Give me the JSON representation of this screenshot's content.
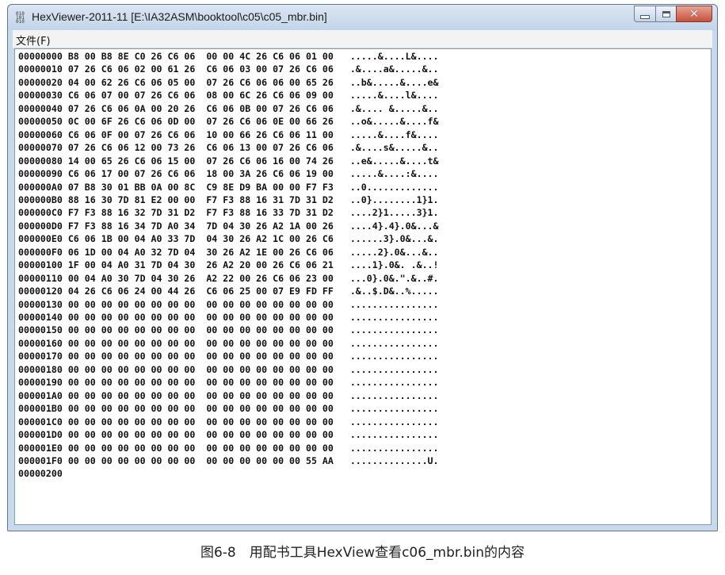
{
  "window": {
    "title": "HexViewer-2011-11 [E:\\IA32ASM\\booktool\\c05\\c05_mbr.bin]",
    "icon": "hex-app-icon"
  },
  "menu": {
    "file_label": "文件(F)"
  },
  "hexdump": {
    "rows": [
      {
        "offset": "00000000",
        "bytes": "B8 00 B8 8E C0 26 C6 06  00 00 4C 26 C6 06 01 00",
        "ascii": ".....&....L&...."
      },
      {
        "offset": "00000010",
        "bytes": "07 26 C6 06 02 00 61 26  C6 06 03 00 07 26 C6 06",
        "ascii": ".&....a&.....&.."
      },
      {
        "offset": "00000020",
        "bytes": "04 00 62 26 C6 06 05 00  07 26 C6 06 06 00 65 26",
        "ascii": "..b&.....&....e&"
      },
      {
        "offset": "00000030",
        "bytes": "C6 06 07 00 07 26 C6 06  08 00 6C 26 C6 06 09 00",
        "ascii": ".....&....l&...."
      },
      {
        "offset": "00000040",
        "bytes": "07 26 C6 06 0A 00 20 26  C6 06 0B 00 07 26 C6 06",
        "ascii": ".&.... &.....&.."
      },
      {
        "offset": "00000050",
        "bytes": "0C 00 6F 26 C6 06 0D 00  07 26 C6 06 0E 00 66 26",
        "ascii": "..o&.....&....f&"
      },
      {
        "offset": "00000060",
        "bytes": "C6 06 0F 00 07 26 C6 06  10 00 66 26 C6 06 11 00",
        "ascii": ".....&....f&...."
      },
      {
        "offset": "00000070",
        "bytes": "07 26 C6 06 12 00 73 26  C6 06 13 00 07 26 C6 06",
        "ascii": ".&....s&.....&.."
      },
      {
        "offset": "00000080",
        "bytes": "14 00 65 26 C6 06 15 00  07 26 C6 06 16 00 74 26",
        "ascii": "..e&.....&....t&"
      },
      {
        "offset": "00000090",
        "bytes": "C6 06 17 00 07 26 C6 06  18 00 3A 26 C6 06 19 00",
        "ascii": ".....&....:&...."
      },
      {
        "offset": "000000A0",
        "bytes": "07 B8 30 01 BB 0A 00 8C  C9 8E D9 BA 00 00 F7 F3",
        "ascii": "..0............."
      },
      {
        "offset": "000000B0",
        "bytes": "88 16 30 7D 81 E2 00 00  F7 F3 88 16 31 7D 31 D2",
        "ascii": "..0}........1}1."
      },
      {
        "offset": "000000C0",
        "bytes": "F7 F3 88 16 32 7D 31 D2  F7 F3 88 16 33 7D 31 D2",
        "ascii": "....2}1.....3}1."
      },
      {
        "offset": "000000D0",
        "bytes": "F7 F3 88 16 34 7D A0 34  7D 04 30 26 A2 1A 00 26",
        "ascii": "....4}.4}.0&...&"
      },
      {
        "offset": "000000E0",
        "bytes": "C6 06 1B 00 04 A0 33 7D  04 30 26 A2 1C 00 26 C6",
        "ascii": "......3}.0&...&."
      },
      {
        "offset": "000000F0",
        "bytes": "06 1D 00 04 A0 32 7D 04  30 26 A2 1E 00 26 C6 06",
        "ascii": ".....2}.0&...&.."
      },
      {
        "offset": "00000100",
        "bytes": "1F 00 04 A0 31 7D 04 30  26 A2 20 00 26 C6 06 21",
        "ascii": "....1}.0&. .&..!"
      },
      {
        "offset": "00000110",
        "bytes": "00 04 A0 30 7D 04 30 26  A2 22 00 26 C6 06 23 00",
        "ascii": "...0}.0&.\".&..#."
      },
      {
        "offset": "00000120",
        "bytes": "04 26 C6 06 24 00 44 26  C6 06 25 00 07 E9 FD FF",
        "ascii": ".&..$.D&..%....."
      },
      {
        "offset": "00000130",
        "bytes": "00 00 00 00 00 00 00 00  00 00 00 00 00 00 00 00",
        "ascii": "................"
      },
      {
        "offset": "00000140",
        "bytes": "00 00 00 00 00 00 00 00  00 00 00 00 00 00 00 00",
        "ascii": "................"
      },
      {
        "offset": "00000150",
        "bytes": "00 00 00 00 00 00 00 00  00 00 00 00 00 00 00 00",
        "ascii": "................"
      },
      {
        "offset": "00000160",
        "bytes": "00 00 00 00 00 00 00 00  00 00 00 00 00 00 00 00",
        "ascii": "................"
      },
      {
        "offset": "00000170",
        "bytes": "00 00 00 00 00 00 00 00  00 00 00 00 00 00 00 00",
        "ascii": "................"
      },
      {
        "offset": "00000180",
        "bytes": "00 00 00 00 00 00 00 00  00 00 00 00 00 00 00 00",
        "ascii": "................"
      },
      {
        "offset": "00000190",
        "bytes": "00 00 00 00 00 00 00 00  00 00 00 00 00 00 00 00",
        "ascii": "................"
      },
      {
        "offset": "000001A0",
        "bytes": "00 00 00 00 00 00 00 00  00 00 00 00 00 00 00 00",
        "ascii": "................"
      },
      {
        "offset": "000001B0",
        "bytes": "00 00 00 00 00 00 00 00  00 00 00 00 00 00 00 00",
        "ascii": "................"
      },
      {
        "offset": "000001C0",
        "bytes": "00 00 00 00 00 00 00 00  00 00 00 00 00 00 00 00",
        "ascii": "................"
      },
      {
        "offset": "000001D0",
        "bytes": "00 00 00 00 00 00 00 00  00 00 00 00 00 00 00 00",
        "ascii": "................"
      },
      {
        "offset": "000001E0",
        "bytes": "00 00 00 00 00 00 00 00  00 00 00 00 00 00 00 00",
        "ascii": "................"
      },
      {
        "offset": "000001F0",
        "bytes": "00 00 00 00 00 00 00 00  00 00 00 00 00 00 55 AA",
        "ascii": "..............U."
      },
      {
        "offset": "00000200",
        "bytes": "",
        "ascii": ""
      }
    ]
  },
  "caption": "图6-8　用配书工具HexView查看c06_mbr.bin的内容"
}
